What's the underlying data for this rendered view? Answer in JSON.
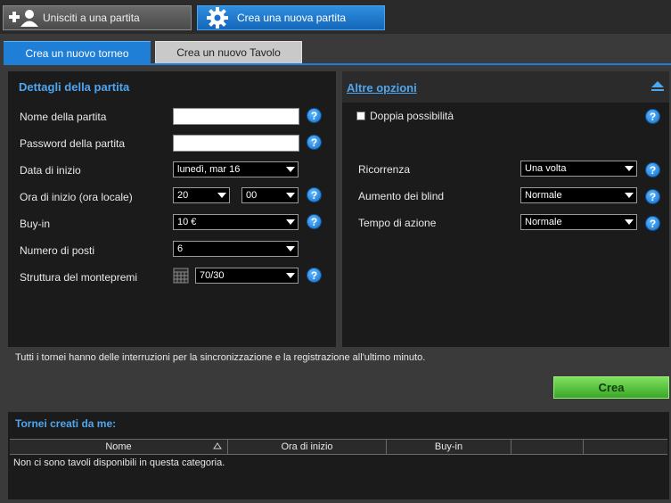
{
  "top_buttons": {
    "join": "Unisciti a una partita",
    "create": "Crea una nuova partita"
  },
  "tabs": {
    "tournament": "Crea un nuovo torneo",
    "table": "Crea un nuovo Tavolo"
  },
  "details": {
    "title": "Dettagli della partita",
    "game_name_label": "Nome della partita",
    "game_name_value": "",
    "password_label": "Password della partita",
    "password_value": "",
    "start_date_label": "Data di inizio",
    "start_date_value": "lunedì, mar 16",
    "start_time_label": "Ora di inizio (ora locale)",
    "start_hour_value": "20",
    "start_minute_value": "00",
    "buyin_label": "Buy-in",
    "buyin_value": "10 €",
    "seats_label": "Numero di posti",
    "seats_value": "6",
    "prize_label": "Struttura del montepremi",
    "prize_value": "70/30"
  },
  "options": {
    "title": "Altre opzioni",
    "double_chance_label": "Doppia possibilità",
    "double_chance_checked": false,
    "recurrence_label": "Ricorrenza",
    "recurrence_value": "Una volta",
    "blind_label": "Aumento dei blind",
    "blind_value": "Normale",
    "action_label": "Tempo di azione",
    "action_value": "Normale"
  },
  "note": "Tutti i tornei hanno delle interruzioni per la sincronizzazione e la registrazione all'ultimo minuto.",
  "create_button": "Crea",
  "my_tournaments": {
    "title": "Tornei creati da me:",
    "columns": [
      "Nome",
      "Ora di inizio",
      "Buy-in",
      "",
      ""
    ],
    "empty_message": "Non ci sono tavoli disponibili in questa categoria."
  },
  "colors": {
    "accent_blue": "#1f7fd6",
    "header_text": "#4ea6ef",
    "create_green": "#3aa629",
    "panel_bg": "#1b1b1b"
  },
  "icons": {
    "join": "add-user-icon",
    "create": "gear-icon",
    "help": "help-icon",
    "calendar": "calendar-icon",
    "collapse": "collapse-up-icon",
    "sort": "sort-asc-icon"
  }
}
